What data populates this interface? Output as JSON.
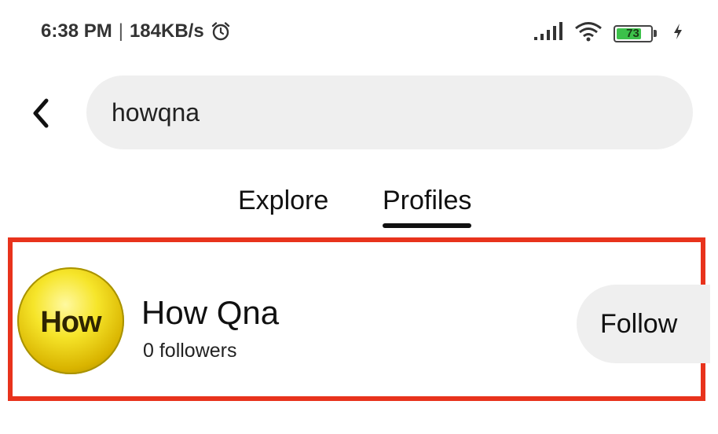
{
  "status_bar": {
    "time": "6:38 PM",
    "separator": "|",
    "network_speed": "184KB/s",
    "battery_level": "73",
    "battery_fraction": 0.73,
    "icons": [
      "alarm-icon",
      "signal-icon",
      "wifi-icon",
      "battery-icon",
      "charging-icon"
    ]
  },
  "search": {
    "value": "howqna",
    "back_icon": "chevron-left-icon"
  },
  "tabs": [
    {
      "label": "Explore",
      "active": false
    },
    {
      "label": "Profiles",
      "active": true
    }
  ],
  "result": {
    "avatar_text": "How",
    "name": "How Qna",
    "followers": "0 followers",
    "follow_label": "Follow"
  },
  "colors": {
    "highlight": "#e8331c",
    "battery_fill": "#3cc14a",
    "search_bg": "#efefef"
  }
}
